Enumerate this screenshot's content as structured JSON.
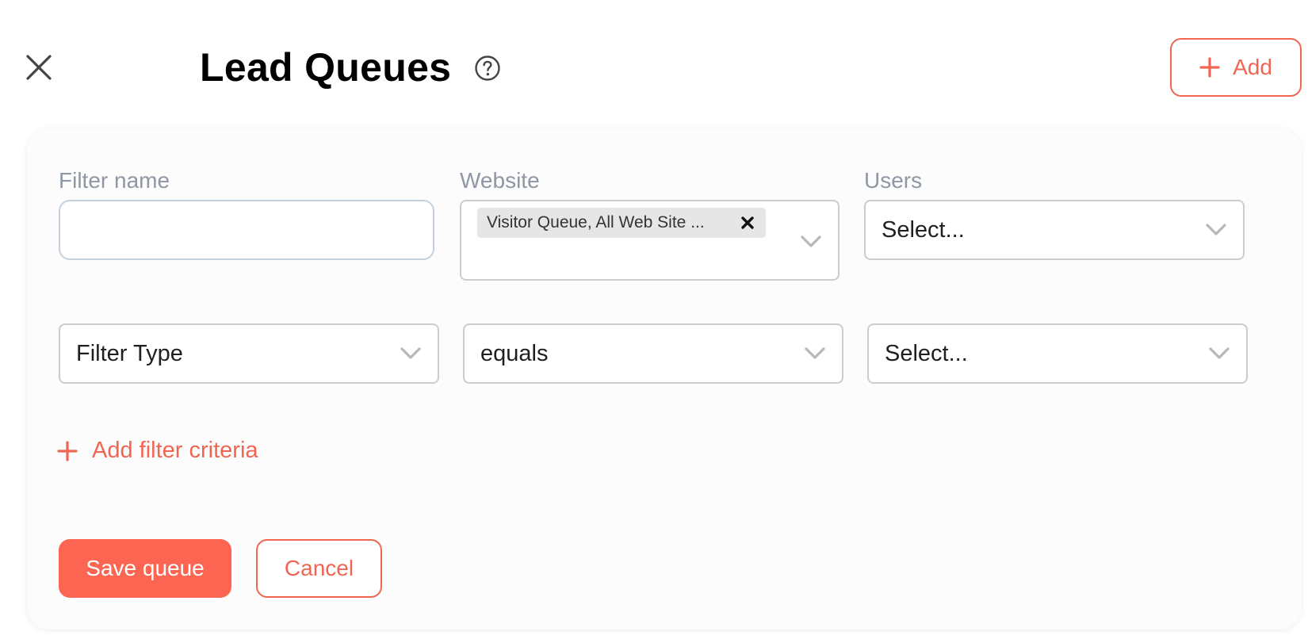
{
  "header": {
    "title": "Lead Queues",
    "close_icon": "close-icon",
    "help_icon": "help-circle-icon",
    "add_label": "Add"
  },
  "form": {
    "filter_name": {
      "label": "Filter name",
      "value": "",
      "placeholder": ""
    },
    "website": {
      "label": "Website",
      "selected_chip": "Visitor Queue, All Web Site ..."
    },
    "users": {
      "label": "Users",
      "placeholder": "Select..."
    },
    "criteria": {
      "filter_type": "Filter Type",
      "operator": "equals",
      "value_placeholder": "Select..."
    },
    "add_criteria_label": "Add filter criteria"
  },
  "actions": {
    "save_label": "Save queue",
    "cancel_label": "Cancel"
  },
  "colors": {
    "accent": "#f06652",
    "primary_button": "#fb6552",
    "label_gray": "#8e97a3"
  }
}
